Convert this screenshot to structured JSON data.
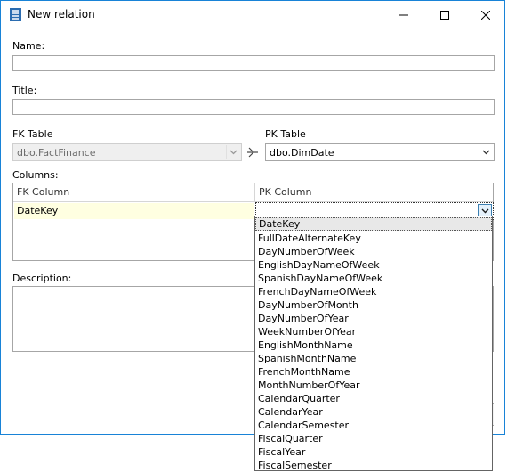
{
  "window": {
    "title": "New relation",
    "accent_color": "#1883d7",
    "icon": "database-icon"
  },
  "controls": {
    "minimize_icon": "minimize-icon",
    "maximize_icon": "maximize-icon",
    "close_icon": "close-icon"
  },
  "form": {
    "name_label": "Name:",
    "name_value": "",
    "title_label": "Title:",
    "title_value": "",
    "fk_table_label": "FK Table",
    "fk_table_value": "dbo.FactFinance",
    "pk_table_label": "PK Table",
    "pk_table_value": "dbo.DimDate",
    "relation_icon": "relation-arrow-icon",
    "columns_label": "Columns:",
    "description_label": "Description:",
    "description_value": ""
  },
  "columns_grid": {
    "headers": [
      "FK Column",
      "PK Column"
    ],
    "rows": [
      {
        "fk": "DateKey",
        "pk": ""
      }
    ]
  },
  "dropdown": {
    "selected": "DateKey",
    "options": [
      "DateKey",
      "FullDateAlternateKey",
      "DayNumberOfWeek",
      "EnglishDayNameOfWeek",
      "SpanishDayNameOfWeek",
      "FrenchDayNameOfWeek",
      "DayNumberOfMonth",
      "DayNumberOfYear",
      "WeekNumberOfYear",
      "EnglishMonthName",
      "SpanishMonthName",
      "FrenchMonthName",
      "MonthNumberOfYear",
      "CalendarQuarter",
      "CalendarYear",
      "CalendarSemester",
      "FiscalQuarter",
      "FiscalYear",
      "FiscalSemester"
    ]
  }
}
